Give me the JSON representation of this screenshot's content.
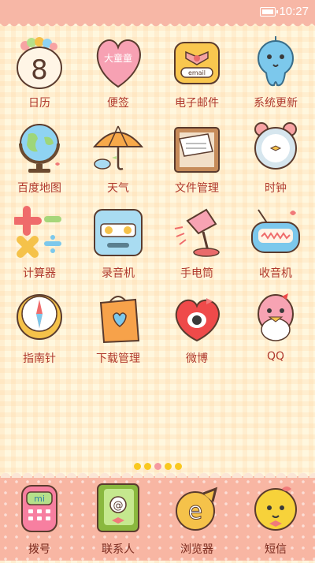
{
  "status": {
    "time": "10:27"
  },
  "apps": [
    {
      "label": "日历",
      "icon": "calendar-icon"
    },
    {
      "label": "便签",
      "icon": "note-icon"
    },
    {
      "label": "电子邮件",
      "icon": "email-icon"
    },
    {
      "label": "系统更新",
      "icon": "update-icon"
    },
    {
      "label": "百度地图",
      "icon": "globe-icon"
    },
    {
      "label": "天气",
      "icon": "umbrella-icon"
    },
    {
      "label": "文件管理",
      "icon": "folder-icon"
    },
    {
      "label": "时钟",
      "icon": "alarm-clock-icon"
    },
    {
      "label": "计算器",
      "icon": "calculator-icon"
    },
    {
      "label": "录音机",
      "icon": "recorder-icon"
    },
    {
      "label": "手电筒",
      "icon": "flashlight-icon"
    },
    {
      "label": "收音机",
      "icon": "radio-icon"
    },
    {
      "label": "指南针",
      "icon": "compass-icon"
    },
    {
      "label": "下载管理",
      "icon": "download-bag-icon"
    },
    {
      "label": "微博",
      "icon": "weibo-icon"
    },
    {
      "label": "QQ",
      "icon": "qq-penguin-icon"
    }
  ],
  "calendar_day": "8",
  "note_text": "大童童",
  "email_text": "email",
  "dock": [
    {
      "label": "拨号",
      "icon": "phone-icon",
      "badge": "mi"
    },
    {
      "label": "联系人",
      "icon": "contacts-icon"
    },
    {
      "label": "浏览器",
      "icon": "browser-icon"
    },
    {
      "label": "短信",
      "icon": "message-icon"
    }
  ],
  "pager": {
    "count": 5,
    "active": 2
  },
  "colors": {
    "accent": "#f7b7a6",
    "label": "#b03a2e",
    "dot": "#f9c81f",
    "dot_active": "#f59aa0"
  }
}
